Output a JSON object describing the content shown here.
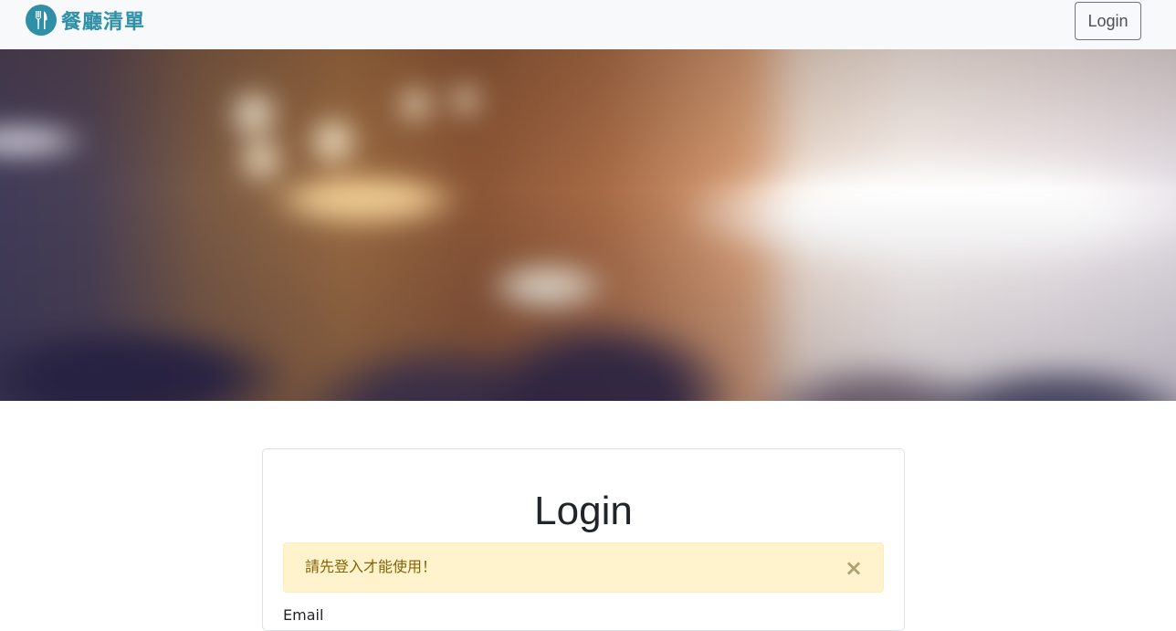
{
  "navbar": {
    "brand_text": "餐廳清單",
    "brand_icon": "fork-knife-icon",
    "login_label": "Login"
  },
  "hero": {
    "image_description_icon": "restaurant-photo"
  },
  "login_card": {
    "title": "Login",
    "alert": {
      "message": "請先登入才能使用！",
      "close_glyph": "×"
    },
    "email_label": "Email"
  },
  "colors": {
    "brand": "#2e8fa6",
    "navbar_bg": "#f8f9fa",
    "alert_bg": "#fff3cd",
    "alert_text": "#856404"
  }
}
